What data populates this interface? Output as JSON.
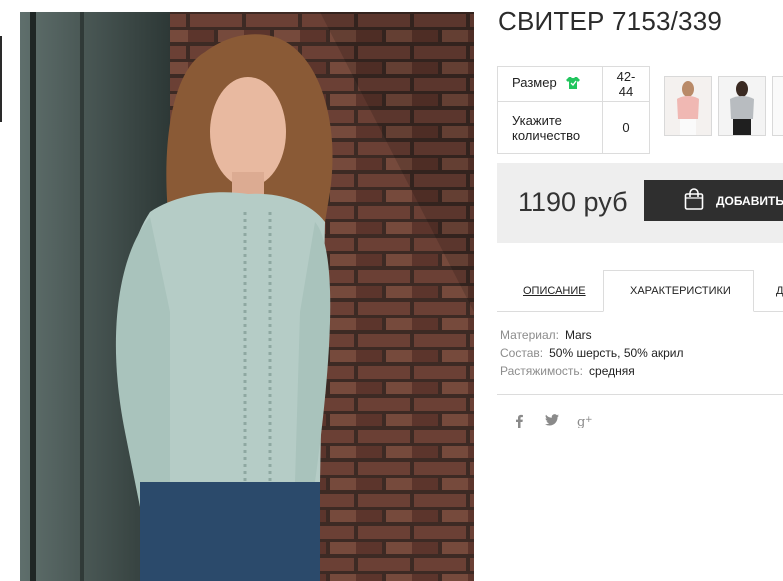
{
  "product": {
    "title": "СВИТЕР 7153/339",
    "options": [
      {
        "label": "Размер",
        "value": "42-44",
        "icon": "shirt-icon"
      },
      {
        "label": "Укажите количество",
        "value": "0"
      }
    ],
    "price": "1190 руб",
    "add_to_cart_label": "ДОБАВИТЬ В",
    "thumbnails": [
      "thumbnail-pink-sweater",
      "thumbnail-gray-sweater",
      "thumbnail-partial"
    ]
  },
  "tabs": [
    {
      "label": "ОПИСАНИЕ",
      "active": false
    },
    {
      "label": "ХАРАКТЕРИСТИКИ",
      "active": true
    },
    {
      "label": "Д",
      "active": false
    }
  ],
  "characteristics": [
    {
      "key": "Материал:",
      "value": "Mars"
    },
    {
      "key": "Состав:",
      "value": "50% шерсть, 50% акрил"
    },
    {
      "key": "Растяжимость:",
      "value": "средняя"
    }
  ],
  "social": [
    {
      "name": "facebook-icon",
      "glyph": "f"
    },
    {
      "name": "twitter-icon",
      "glyph": "🐦"
    },
    {
      "name": "google-plus-icon",
      "glyph": "g+"
    }
  ],
  "colors": {
    "icon_green": "#22c55e",
    "button_bg": "#2f2f2f",
    "price_box_bg": "#eeeeee"
  }
}
